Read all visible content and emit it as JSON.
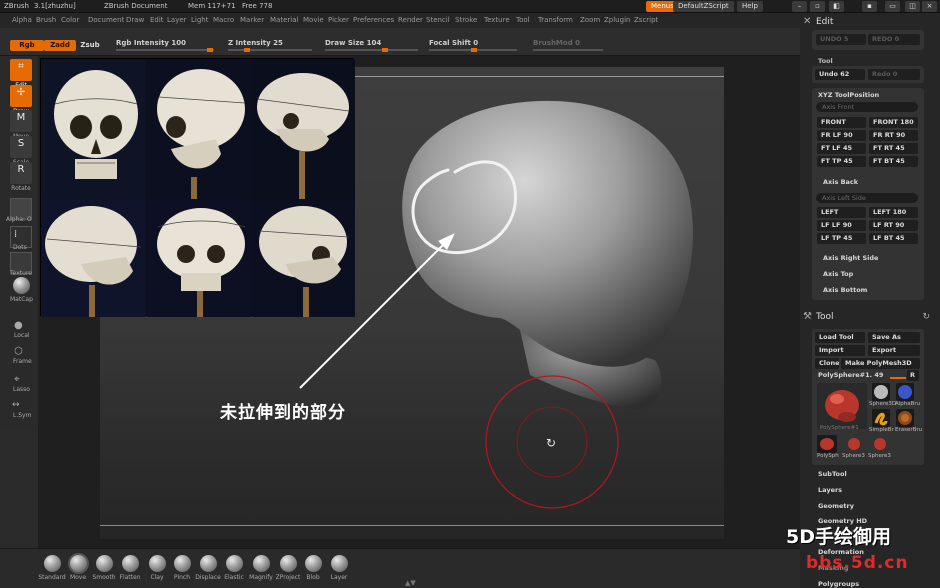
{
  "titlebar": {
    "app": "ZBrush",
    "version": "3.1[zhuzhu]",
    "document": "ZBrush Document",
    "memory": "Mem 117+71",
    "free": "Free 778",
    "menus_button": "Menus",
    "script_button": "DefaultZScript",
    "help_button": "Help"
  },
  "menubar": [
    "Alpha",
    "Brush",
    "Color",
    "Document",
    "Draw",
    "Edit",
    "Layer",
    "Light",
    "Macro",
    "Marker",
    "Material",
    "Movie",
    "Picker",
    "Preferences",
    "Render",
    "Stencil",
    "Stroke",
    "Texture",
    "Tool",
    "Transform",
    "Zoom",
    "Zplugin",
    "Zscript"
  ],
  "topbar": {
    "rgb": "Rgb",
    "zadd": "Zadd",
    "zsub": "Zsub",
    "rgb_intensity": "Rgb Intensity 100",
    "z_intensity": "Z Intensity 25",
    "draw_size": "Draw Size 104",
    "focal_shift": "Focal Shift 0",
    "brush_mod": "BrushMod 0"
  },
  "left_tools": {
    "edit": "Edit",
    "draw": "Draw",
    "move": "Move",
    "scale": "Scale",
    "rotate": "Rotate",
    "alpha": "Alpha: O",
    "dots": "Dots",
    "texture": "Texture",
    "matcap": "MatCap",
    "local": "Local",
    "frame": "Frame",
    "lasso": "Lasso",
    "lsym": "L.Sym"
  },
  "annotation": "未拉伸到的部分",
  "brushes": [
    "Standard",
    "Move",
    "Smooth",
    "Flatten",
    "Clay",
    "Pinch",
    "Displace",
    "Elastic",
    "Magnify",
    "ZProject",
    "Blob",
    "Layer"
  ],
  "right_panel": {
    "edit_title": "Edit",
    "undo_s": "UNDO 5",
    "redo_s": "REDO 0",
    "tool_label": "Tool",
    "undo_t": "Undo 62",
    "redo_t": "Redo 0",
    "xyz_title": "XYZ ToolPosition",
    "axis_front": "Axis Front",
    "front_buttons": [
      "FRONT",
      "FRONT 180",
      "FR LF 90",
      "FR RT 90",
      "FT LF 45",
      "FT RT 45",
      "FT TP 45",
      "FT BT 45"
    ],
    "axis_back": "Axis Back",
    "axis_left_side": "Axis Left Side",
    "left_buttons": [
      "LEFT",
      "LEFT 180",
      "LF LF 90",
      "LF RT 90",
      "LF TP 45",
      "LF BT 45"
    ],
    "axis_right_side": "Axis Right Side",
    "axis_top": "Axis Top",
    "axis_bottom": "Axis Bottom",
    "tool_title": "Tool",
    "load_tool": "Load Tool",
    "save_as": "Save As",
    "import": "Import",
    "export": "Export",
    "clone": "Clone",
    "make_polymesh": "Make PolyMesh3D",
    "current_tool": "PolySphere#1. 49",
    "r_button": "R",
    "tool_thumbs": [
      "PolySphere#1",
      "Sphere3D",
      "AlphaBru",
      "SimpleBr",
      "EraserBru",
      "PolySph",
      "Sphere3",
      "Sphere3"
    ],
    "subsections": [
      "SubTool",
      "Layers",
      "Geometry",
      "Geometry HD",
      "Deformation",
      "Masking",
      "Polygroups"
    ]
  },
  "watermark": {
    "line1": "5D手绘御用",
    "line2": "bbs.5d.cn"
  }
}
